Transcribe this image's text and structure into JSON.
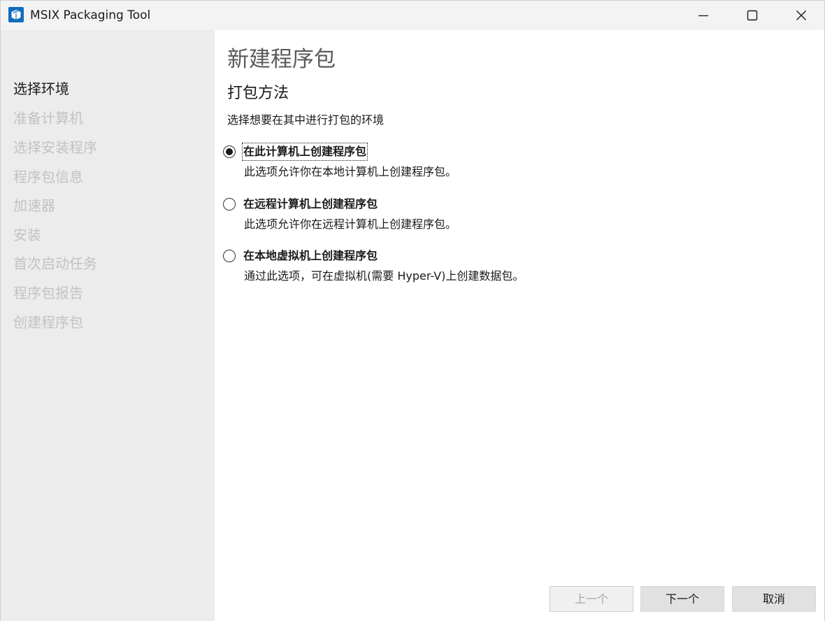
{
  "window": {
    "title": "MSIX Packaging Tool",
    "icon": "msix-box-icon",
    "controls": {
      "minimize": "minimize-icon",
      "maximize": "maximize-icon",
      "close": "close-icon"
    }
  },
  "sidebar": {
    "items": [
      {
        "label": "选择环境",
        "active": true
      },
      {
        "label": "准备计算机",
        "active": false
      },
      {
        "label": "选择安装程序",
        "active": false
      },
      {
        "label": "程序包信息",
        "active": false
      },
      {
        "label": "加速器",
        "active": false
      },
      {
        "label": "安装",
        "active": false
      },
      {
        "label": "首次启动任务",
        "active": false
      },
      {
        "label": "程序包报告",
        "active": false
      },
      {
        "label": "创建程序包",
        "active": false
      }
    ]
  },
  "main": {
    "page_title": "新建程序包",
    "section_title": "打包方法",
    "section_desc": "选择想要在其中进行打包的环境",
    "options": [
      {
        "label": "在此计算机上创建程序包",
        "desc": "此选项允许你在本地计算机上创建程序包。",
        "selected": true
      },
      {
        "label": "在远程计算机上创建程序包",
        "desc": "此选项允许你在远程计算机上创建程序包。",
        "selected": false
      },
      {
        "label": "在本地虚拟机上创建程序包",
        "desc": "通过此选项，可在虚拟机(需要 Hyper-V)上创建数据包。",
        "selected": false
      }
    ]
  },
  "footer": {
    "prev_label": "上一个",
    "next_label": "下一个",
    "cancel_label": "取消",
    "prev_disabled": true
  },
  "colors": {
    "accent": "#0078d4",
    "sidebar_bg": "#ececec",
    "disabled_text": "#c2c2c2"
  }
}
